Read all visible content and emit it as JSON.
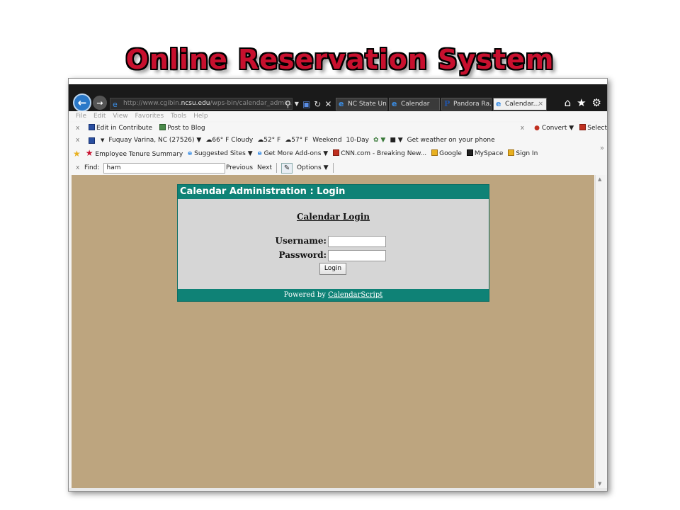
{
  "slide": {
    "title": "Online Reservation System"
  },
  "browser": {
    "address": {
      "prefix": "http://www.cgibin.",
      "domain": "ncsu.edu",
      "path": "/wps-bin/calendar_admin.pl"
    },
    "tabs": [
      {
        "label": "NC State Un...",
        "icon": "ie-icon"
      },
      {
        "label": "Calendar",
        "icon": "ie-icon"
      },
      {
        "label": "Pandora Ra...",
        "icon": "pandora-icon"
      },
      {
        "label": "Calendar...",
        "icon": "ie-icon",
        "active": true
      }
    ],
    "menu": [
      "File",
      "Edit",
      "View",
      "Favorites",
      "Tools",
      "Help"
    ],
    "toolbar1": {
      "edit": "Edit in Contribute",
      "post": "Post to Blog",
      "convert": "Convert",
      "select": "Select"
    },
    "toolbar2": {
      "location": "Fuquay Varina, NC (27526)",
      "now": "66° F Cloudy",
      "t1": "52° F",
      "t2": "57° F",
      "weekend": "Weekend",
      "tenday": "10-Day",
      "weather_phone": "Get weather on your phone"
    },
    "favorites": {
      "items": [
        "Employee Tenure Summary",
        "Suggested Sites",
        "Get More Add-ons",
        "CNN.com - Breaking New...",
        "Google",
        "MySpace",
        "Sign In"
      ]
    },
    "find": {
      "label": "Find:",
      "value": "ham",
      "previous": "Previous",
      "next": "Next",
      "options": "Options"
    }
  },
  "page": {
    "header": "Calendar Administration : Login",
    "heading": "Calendar Login",
    "username_label": "Username:",
    "password_label": "Password:",
    "login_button": "Login",
    "footer_prefix": "Powered by",
    "footer_link": "CalendarScript"
  },
  "colors": {
    "slide_title": "#c8102e",
    "panel_teal": "#0f8276",
    "page_bg": "#bda57f"
  }
}
